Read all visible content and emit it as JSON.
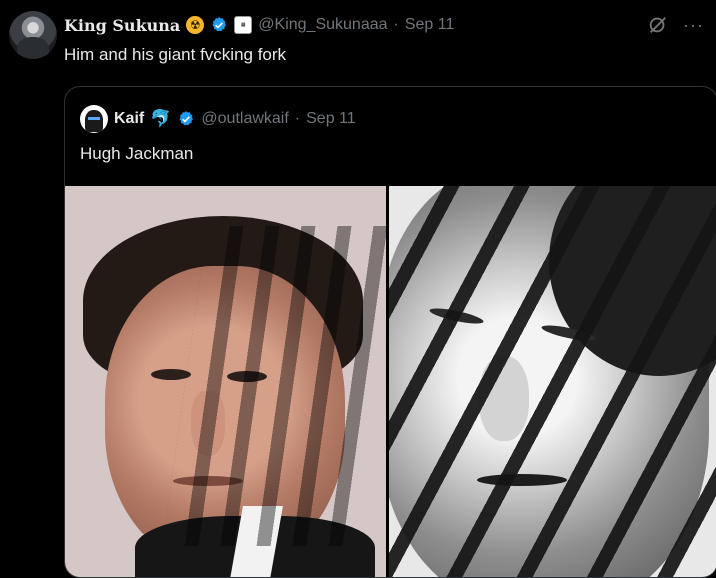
{
  "tweet": {
    "author_name": "King Sukuna",
    "handle": "@King_Sukunaaa",
    "separator": "·",
    "date": "Sep 11",
    "text": "Him and his giant fvcking fork",
    "more_label": "···"
  },
  "quote": {
    "author_name": "Kaif",
    "handle": "@outlawkaif",
    "separator": "·",
    "date": "Sep 11",
    "text": "Hugh Jackman"
  },
  "icons": {
    "radio": "radioactive-icon",
    "verified": "verified-badge-icon",
    "affiliate": "affiliate-badge-icon",
    "grok": "grok-icon",
    "more": "more-icon",
    "dolphin": "dolphin-icon"
  },
  "colors": {
    "background": "#000000",
    "text_primary": "#e7e9ea",
    "text_secondary": "#71767b",
    "verified": "#1d9bf0",
    "border": "#2f3336"
  }
}
